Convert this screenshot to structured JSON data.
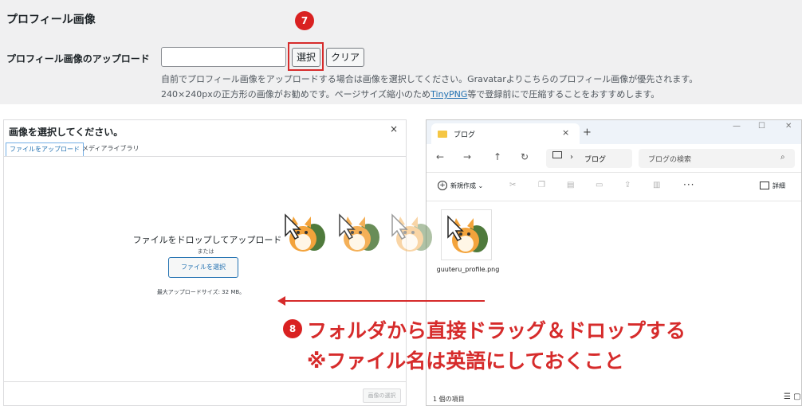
{
  "settings": {
    "section_title": "プロフィール画像",
    "upload_label": "プロフィール画像のアップロード",
    "input_value": "",
    "select_button": "選択",
    "clear_button": "クリア",
    "desc_line1": "自前でプロフィール画像をアップロードする場合は画像を選択してください。Gravatarよりこちらのプロフィール画像が優先されます。",
    "desc_line2_pre": "240×240pxの正方形の画像がお勧めです。ページサイズ縮小のため",
    "desc_link": "TinyPNG",
    "desc_line2_post": "等で登録前にで圧縮することをおすすめします。"
  },
  "step7": "7",
  "modal": {
    "title": "画像を選択してください。",
    "close": "×",
    "tab_upload": "ファイルをアップロード",
    "tab_library": "メディアライブラリ",
    "drop_text": "ファイルをドロップしてアップロード",
    "or_text": "または",
    "choose_button": "ファイルを選択",
    "max_size": "最大アップロードサイズ: 32 MB。",
    "select_image_button": "画像の選択"
  },
  "explorer": {
    "tab_title": "ブログ",
    "tab_close": "×",
    "new_tab": "+",
    "win_min": "—",
    "win_max": "☐",
    "win_close": "✕",
    "nav_back": "←",
    "nav_forward": "→",
    "nav_up": "↑",
    "nav_refresh": "↻",
    "addr_sep": "›",
    "address": "ブログ",
    "search_placeholder": "ブログの検索",
    "search_icon": "⌕",
    "new_button": "新規作成",
    "new_chevron": "⌄",
    "more": "···",
    "details": "詳細",
    "file_name": "guuteru_profile.png",
    "status": "1 個の項目",
    "view_icons": "☰ ▢"
  },
  "toolbar_icons": [
    "cut-icon",
    "copy-icon",
    "paste-icon",
    "rename-icon",
    "share-icon",
    "delete-icon"
  ],
  "step8": "8",
  "annotation": {
    "line1": "フォルダから直接ドラッグ＆ドロップする",
    "line2": "※ファイル名は英語にしておくこと"
  },
  "colors": {
    "accent_red": "#d62b2b",
    "wp_blue": "#2271b1",
    "folder_yellow": "#f5c644"
  }
}
